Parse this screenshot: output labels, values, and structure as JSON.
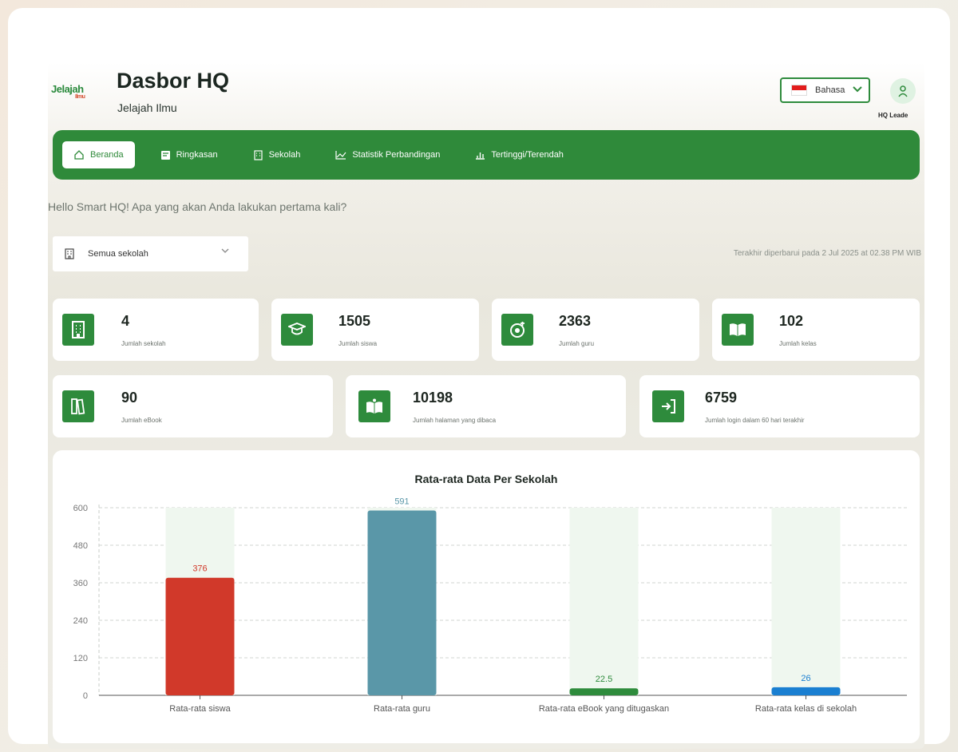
{
  "header": {
    "logo_text": "Jelajah",
    "logo_sub": "Ilmu",
    "title": "Dasbor HQ",
    "subtitle": "Jelajah Ilmu",
    "language_label": "Bahasa",
    "role_label": "HQ Leade"
  },
  "nav": {
    "items": [
      {
        "label": "Beranda",
        "icon": "home-icon",
        "active": true
      },
      {
        "label": "Ringkasan",
        "icon": "summary-icon",
        "active": false
      },
      {
        "label": "Sekolah",
        "icon": "building-icon",
        "active": false
      },
      {
        "label": "Statistik Perbandingan",
        "icon": "line-chart-icon",
        "active": false
      },
      {
        "label": "Tertinggi/Terendah",
        "icon": "bar-chart-icon",
        "active": false
      }
    ]
  },
  "greeting": "Hello Smart HQ! Apa yang akan Anda lakukan pertama kali?",
  "filter": {
    "selected": "Semua sekolah"
  },
  "last_updated": "Terakhir diperbarui pada 2 Jul 2025 at 02.38 PM WIB",
  "stats_row1": [
    {
      "value": "4",
      "label": "Jumlah sekolah",
      "icon": "building-icon"
    },
    {
      "value": "1505",
      "label": "Jumlah siswa",
      "icon": "graduation-cap-icon"
    },
    {
      "value": "2363",
      "label": "Jumlah guru",
      "icon": "teacher-icon"
    },
    {
      "value": "102",
      "label": "Jumlah kelas",
      "icon": "open-book-icon"
    }
  ],
  "stats_row2": [
    {
      "value": "90",
      "label": "Jumlah eBook",
      "icon": "books-icon"
    },
    {
      "value": "10198",
      "label": "Jumlah halaman yang dibaca",
      "icon": "reading-icon"
    },
    {
      "value": "6759",
      "label": "Jumlah login dalam 60 hari terakhir",
      "icon": "login-icon"
    }
  ],
  "colors": {
    "primary": "#2f8a3a",
    "bar1": "#d1392a",
    "bar2": "#5a97a8",
    "bar3": "#2e8b3c",
    "bar4": "#1a7fd1"
  },
  "chart_data": {
    "type": "bar",
    "title": "Rata-rata Data Per Sekolah",
    "categories": [
      "Rata-rata siswa",
      "Rata-rata guru",
      "Rata-rata eBook yang ditugaskan",
      "Rata-rata kelas di sekolah"
    ],
    "values": [
      376,
      591,
      22.5,
      26
    ],
    "data_labels": [
      "376",
      "591",
      "22.5",
      "26"
    ],
    "bar_colors": [
      "#d1392a",
      "#5a97a8",
      "#2e8b3c",
      "#1a7fd1"
    ],
    "yticks": [
      0,
      120,
      240,
      360,
      480,
      600
    ],
    "ylim": [
      0,
      600
    ],
    "grid": true
  }
}
